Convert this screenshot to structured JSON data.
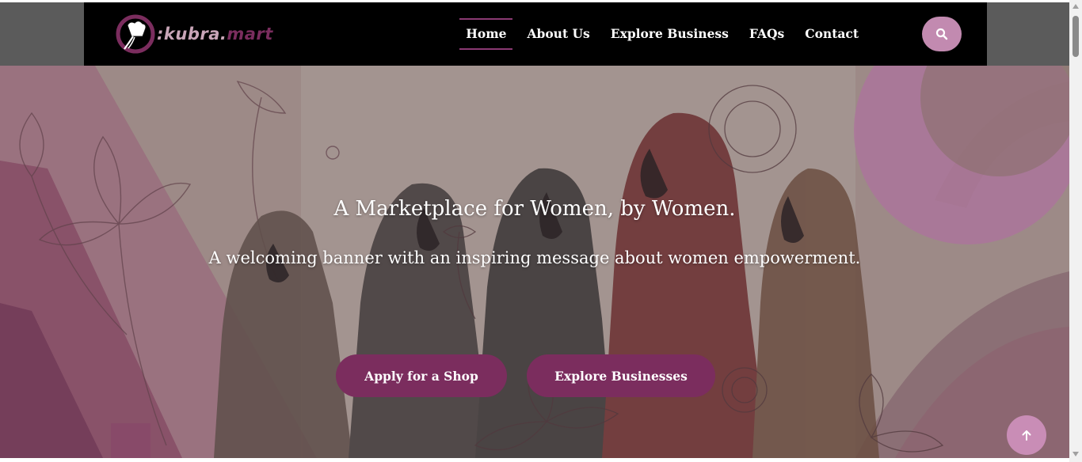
{
  "brand": {
    "logo_text_light": "kubra",
    "logo_text_accent": "mart",
    "logo_icon": "chef-hat-whisk-icon",
    "accent_color": "#7b2d5e",
    "pink_color": "#c28ab0"
  },
  "nav": {
    "items": [
      {
        "label": "Home",
        "active": true
      },
      {
        "label": "About Us",
        "active": false
      },
      {
        "label": "Explore Business",
        "active": false
      },
      {
        "label": "FAQs",
        "active": false
      },
      {
        "label": "Contact",
        "active": false
      }
    ],
    "search_icon": "search-icon"
  },
  "hero": {
    "title": "A Marketplace for Women, by Women.",
    "subtitle": "A welcoming banner with an inspiring message about women empowerment.",
    "primary_button": "Apply for a Shop",
    "secondary_button": "Explore Businesses"
  },
  "scroll_top_icon": "arrow-up-icon"
}
